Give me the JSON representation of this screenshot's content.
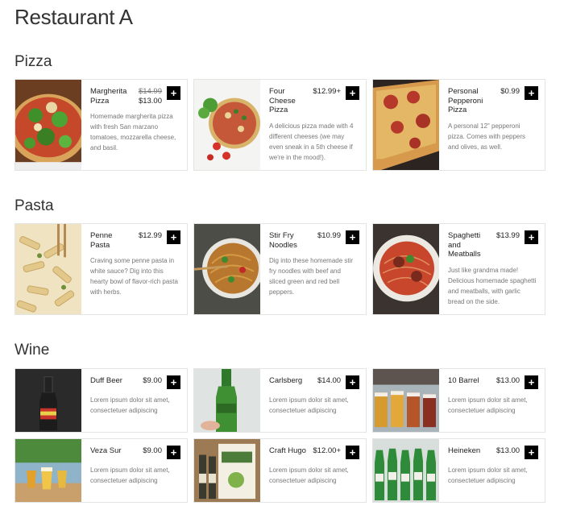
{
  "restaurant": {
    "name": "Restaurant A"
  },
  "sections": [
    {
      "title": "Pizza",
      "items": [
        {
          "name": "Margherita Pizza",
          "old_price": "$14.99",
          "price": "$13.00",
          "description": "Homemade margherita pizza with fresh San marzano tomatoes, mozzarella cheese, and basil.",
          "image": "margherita-pizza"
        },
        {
          "name": "Four Cheese Pizza",
          "old_price": "",
          "price": "$12.99+",
          "description": "A delicious pizza made with 4 different cheeses (we may even sneak in a 5th cheese if we're in the mood!).",
          "image": "four-cheese-pizza"
        },
        {
          "name": "Personal Pepperoni Pizza",
          "old_price": "",
          "price": "$0.99",
          "description": "A personal 12\" pepperoni pizza. Comes with peppers and olives, as well.",
          "image": "pepperoni-pizza"
        }
      ]
    },
    {
      "title": "Pasta",
      "items": [
        {
          "name": "Penne Pasta",
          "old_price": "",
          "price": "$12.99",
          "description": "Craving some penne pasta in white sauce? Dig into this hearty bowl of flavor-rich pasta with herbs.",
          "image": "penne-pasta"
        },
        {
          "name": "Stir Fry Noodles",
          "old_price": "",
          "price": "$10.99",
          "description": "Dig into these homemade stir fry noodles with beef and sliced green and red bell peppers.",
          "image": "stir-fry-noodles"
        },
        {
          "name": "Spaghetti and Meatballs",
          "old_price": "",
          "price": "$13.99",
          "description": "Just like grandma made! Delicious homemade spaghetti and meatballs, with garlic bread on the side.",
          "image": "spaghetti-meatballs"
        }
      ]
    },
    {
      "title": "Wine",
      "items": [
        {
          "name": "Duff Beer",
          "old_price": "",
          "price": "$9.00",
          "description": "Lorem ipsum dolor sit amet, consectetuer adipiscing",
          "image": "duff-beer"
        },
        {
          "name": "Carlsberg",
          "old_price": "",
          "price": "$14.00",
          "description": "Lorem ipsum dolor sit amet, consectetuer adipiscing",
          "image": "carlsberg"
        },
        {
          "name": "10 Barrel",
          "old_price": "",
          "price": "$13.00",
          "description": "Lorem ipsum dolor sit amet, consectetuer adipiscing",
          "image": "10-barrel"
        },
        {
          "name": "Veza Sur",
          "old_price": "",
          "price": "$9.00",
          "description": "Lorem ipsum dolor sit amet, consectetuer adipiscing",
          "image": "veza-sur"
        },
        {
          "name": "Craft Hugo",
          "old_price": "",
          "price": "$12.00+",
          "description": "Lorem ipsum dolor sit amet, consectetuer adipiscing",
          "image": "craft-hugo"
        },
        {
          "name": "Heineken",
          "old_price": "",
          "price": "$13.00",
          "description": "Lorem ipsum dolor sit amet, consectetuer adipiscing",
          "image": "heineken"
        }
      ]
    }
  ],
  "add_button": {
    "symbol": "+"
  }
}
